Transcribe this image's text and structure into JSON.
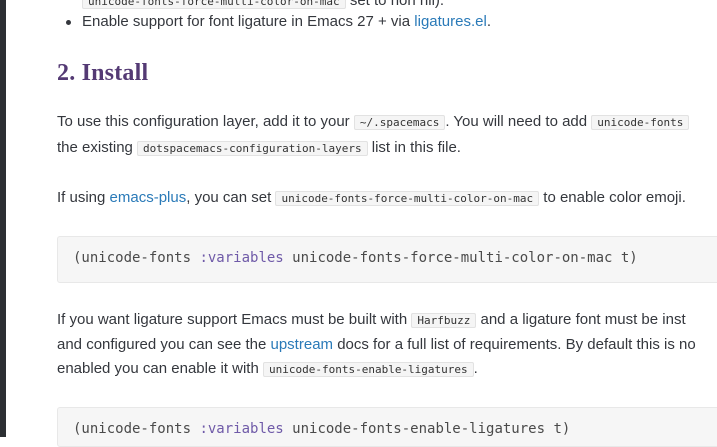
{
  "bullets": [
    {
      "code": "unicode-fonts-force-multi-color-on-mac",
      "suffix": " set to non nil)."
    },
    {
      "prefix": "Enable support for font ligature in Emacs 27 + via ",
      "link": "ligatures.el",
      "suffix": "."
    }
  ],
  "heading": "2. Install",
  "para1": {
    "prefix": "To use this configuration layer, add it to your ",
    "code1": "~/.spacemacs",
    "mid": ". You will need to add ",
    "code2": "unicode-fonts",
    "line2_prefix": "the existing ",
    "code3": "dotspacemacs-configuration-layers",
    "line2_suffix": " list in this file."
  },
  "para2": {
    "prefix": "If using ",
    "link": "emacs-plus",
    "mid": ", you can set ",
    "code": "unicode-fonts-force-multi-color-on-mac",
    "suffix": " to enable color emoji."
  },
  "code_block_1": {
    "open": "(unicode-fonts ",
    "keyword": ":variables",
    "rest": " unicode-fonts-force-multi-color-on-mac t)"
  },
  "para3": {
    "line1_prefix": "If you want ligature support Emacs must be built with ",
    "code1": "Harfbuzz",
    "line1_suffix": " and a ligature font must be inst",
    "line2_prefix": "and configured you can see the ",
    "link": "upstream",
    "line2_suffix": " docs for a full list of requirements. By default this is no",
    "line3_prefix": "enabled you can enable it with ",
    "code2": "unicode-fonts-enable-ligatures",
    "line3_suffix": "."
  },
  "code_block_2": {
    "open": "(unicode-fonts ",
    "keyword": ":variables",
    "rest": " unicode-fonts-enable-ligatures t)"
  }
}
